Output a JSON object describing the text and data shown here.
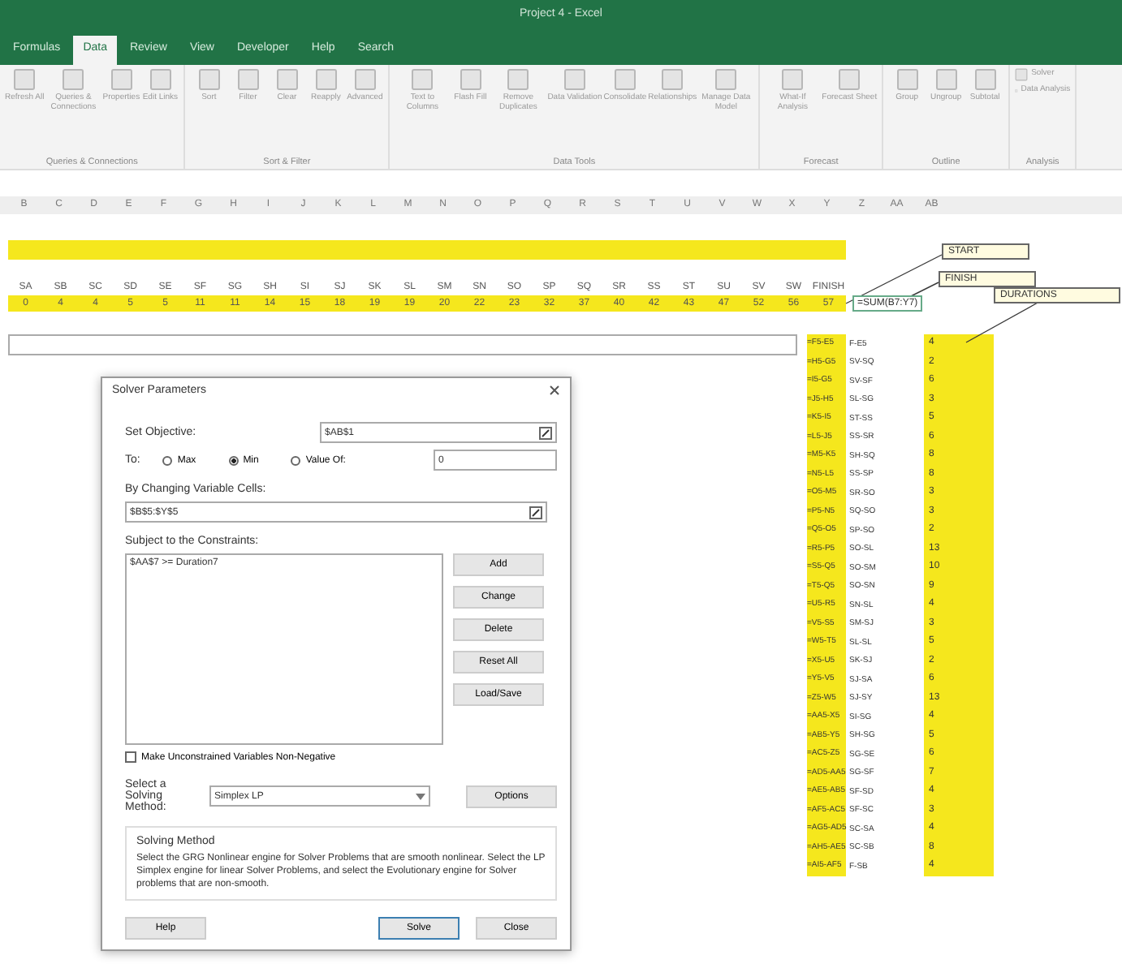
{
  "window": {
    "title": "Project 4 - Excel"
  },
  "tabs": [
    {
      "label": "Formulas",
      "selected": false
    },
    {
      "label": "Data",
      "selected": true
    },
    {
      "label": "Review",
      "selected": false
    },
    {
      "label": "View",
      "selected": false
    },
    {
      "label": "Developer",
      "selected": false
    },
    {
      "label": "Help",
      "selected": false
    },
    {
      "label": "Search",
      "selected": false
    }
  ],
  "ribbon": [
    {
      "name": "Queries & Connections",
      "tools": [
        "Refresh All",
        "Queries & Connections",
        "Properties",
        "Edit Links"
      ]
    },
    {
      "name": "Sort & Filter",
      "tools": [
        "Sort",
        "Filter",
        "Clear",
        "Reapply",
        "Advanced"
      ]
    },
    {
      "name": "Data Tools",
      "tools": [
        "Text to Columns",
        "Flash Fill",
        "Remove Duplicates",
        "Data Validation",
        "Consolidate",
        "Relationships",
        "Manage Data Model"
      ]
    },
    {
      "name": "Forecast",
      "tools": [
        "What-If Analysis",
        "Forecast Sheet"
      ]
    },
    {
      "name": "Outline",
      "tools": [
        "Group",
        "Ungroup",
        "Subtotal"
      ]
    },
    {
      "name": "Analysis",
      "tools": [
        "Solver",
        "Data Analysis"
      ]
    }
  ],
  "columns": [
    "B",
    "C",
    "D",
    "E",
    "F",
    "G",
    "H",
    "I",
    "J",
    "K",
    "L",
    "M",
    "N",
    "O",
    "P",
    "Q",
    "R",
    "S",
    "T",
    "U",
    "V",
    "W",
    "X",
    "Y",
    "Z",
    "AA",
    "AB"
  ],
  "node_labels": [
    "SA",
    "SB",
    "SC",
    "SD",
    "SE",
    "SF",
    "SG",
    "SH",
    "SI",
    "SJ",
    "SK",
    "SL",
    "SM",
    "SN",
    "SO",
    "SP",
    "SQ",
    "SR",
    "SS",
    "ST",
    "SU",
    "SV",
    "SW",
    "FINISH"
  ],
  "node_values": [
    "0",
    "4",
    "4",
    "5",
    "5",
    "11",
    "11",
    "14",
    "15",
    "18",
    "19",
    "19",
    "20",
    "22",
    "23",
    "32",
    "37",
    "40",
    "42",
    "43",
    "47",
    "52",
    "56",
    "57"
  ],
  "total_formula": "=SUM(B7:Y7)",
  "callouts": [
    "START",
    "FINISH",
    "DURATIONS"
  ],
  "activities": [
    {
      "formula": "=F5-E5",
      "name": "F-E5",
      "duration": "4"
    },
    {
      "formula": "=H5-G5",
      "name": "SV-SQ",
      "duration": "2"
    },
    {
      "formula": "=I5-G5",
      "name": "SV-SF",
      "duration": "6"
    },
    {
      "formula": "=J5-H5",
      "name": "SL-SG",
      "duration": "3"
    },
    {
      "formula": "=K5-I5",
      "name": "ST-SS",
      "duration": "5"
    },
    {
      "formula": "=L5-J5",
      "name": "SS-SR",
      "duration": "6"
    },
    {
      "formula": "=M5-K5",
      "name": "SH-SQ",
      "duration": "8"
    },
    {
      "formula": "=N5-L5",
      "name": "SS-SP",
      "duration": "8"
    },
    {
      "formula": "=O5-M5",
      "name": "SR-SO",
      "duration": "3"
    },
    {
      "formula": "=P5-N5",
      "name": "SQ-SO",
      "duration": "3"
    },
    {
      "formula": "=Q5-O5",
      "name": "SP-SO",
      "duration": "2"
    },
    {
      "formula": "=R5-P5",
      "name": "SO-SL",
      "duration": "13"
    },
    {
      "formula": "=S5-Q5",
      "name": "SO-SM",
      "duration": "10"
    },
    {
      "formula": "=T5-Q5",
      "name": "SO-SN",
      "duration": "9"
    },
    {
      "formula": "=U5-R5",
      "name": "SN-SL",
      "duration": "4"
    },
    {
      "formula": "=V5-S5",
      "name": "SM-SJ",
      "duration": "3"
    },
    {
      "formula": "=W5-T5",
      "name": "SL-SL",
      "duration": "5"
    },
    {
      "formula": "=X5-U5",
      "name": "SK-SJ",
      "duration": "2"
    },
    {
      "formula": "=Y5-V5",
      "name": "SJ-SA",
      "duration": "6"
    },
    {
      "formula": "=Z5-W5",
      "name": "SJ-SY",
      "duration": "13"
    },
    {
      "formula": "=AA5-X5",
      "name": "SI-SG",
      "duration": "4"
    },
    {
      "formula": "=AB5-Y5",
      "name": "SH-SG",
      "duration": "5"
    },
    {
      "formula": "=AC5-Z5",
      "name": "SG-SE",
      "duration": "6"
    },
    {
      "formula": "=AD5-AA5",
      "name": "SG-SF",
      "duration": "7"
    },
    {
      "formula": "=AE5-AB5",
      "name": "SF-SD",
      "duration": "4"
    },
    {
      "formula": "=AF5-AC5",
      "name": "SF-SC",
      "duration": "3"
    },
    {
      "formula": "=AG5-AD5",
      "name": "SC-SA",
      "duration": "4"
    },
    {
      "formula": "=AH5-AE5",
      "name": "SC-SB",
      "duration": "8"
    },
    {
      "formula": "=AI5-AF5",
      "name": "F-SB",
      "duration": "4"
    }
  ],
  "dialog": {
    "title": "Solver Parameters",
    "objective_label": "Set Objective:",
    "objective_value": "$AB$1",
    "to_label": "To:",
    "targets": [
      {
        "label": "Max",
        "selected": false
      },
      {
        "label": "Min",
        "selected": true
      },
      {
        "label": "Value Of:",
        "selected": false
      }
    ],
    "value_of": "0",
    "changing_label": "By Changing Variable Cells:",
    "changing_value": "$B$5:$Y$5",
    "constraints_label": "Subject to the Constraints:",
    "constraints": [
      "$AA$7 >= Duration7"
    ],
    "side_buttons": [
      "Add",
      "Change",
      "Delete",
      "Reset All",
      "Load/Save"
    ],
    "nonnegative": {
      "label": "Make Unconstrained Variables Non-Negative",
      "checked": false
    },
    "method_label": "Select a Solving Method:",
    "method_value": "Simplex LP",
    "options_button": "Options",
    "method_title": "Solving Method",
    "method_text": "Select the GRG Nonlinear engine for Solver Problems that are smooth nonlinear. Select the LP Simplex engine for linear Solver Problems, and select the Evolutionary engine for Solver problems that are non-smooth.",
    "footer_buttons": [
      {
        "label": "Help",
        "kind": "plain"
      },
      {
        "label": "Solve",
        "kind": "default"
      },
      {
        "label": "Close",
        "kind": "plain"
      }
    ]
  }
}
